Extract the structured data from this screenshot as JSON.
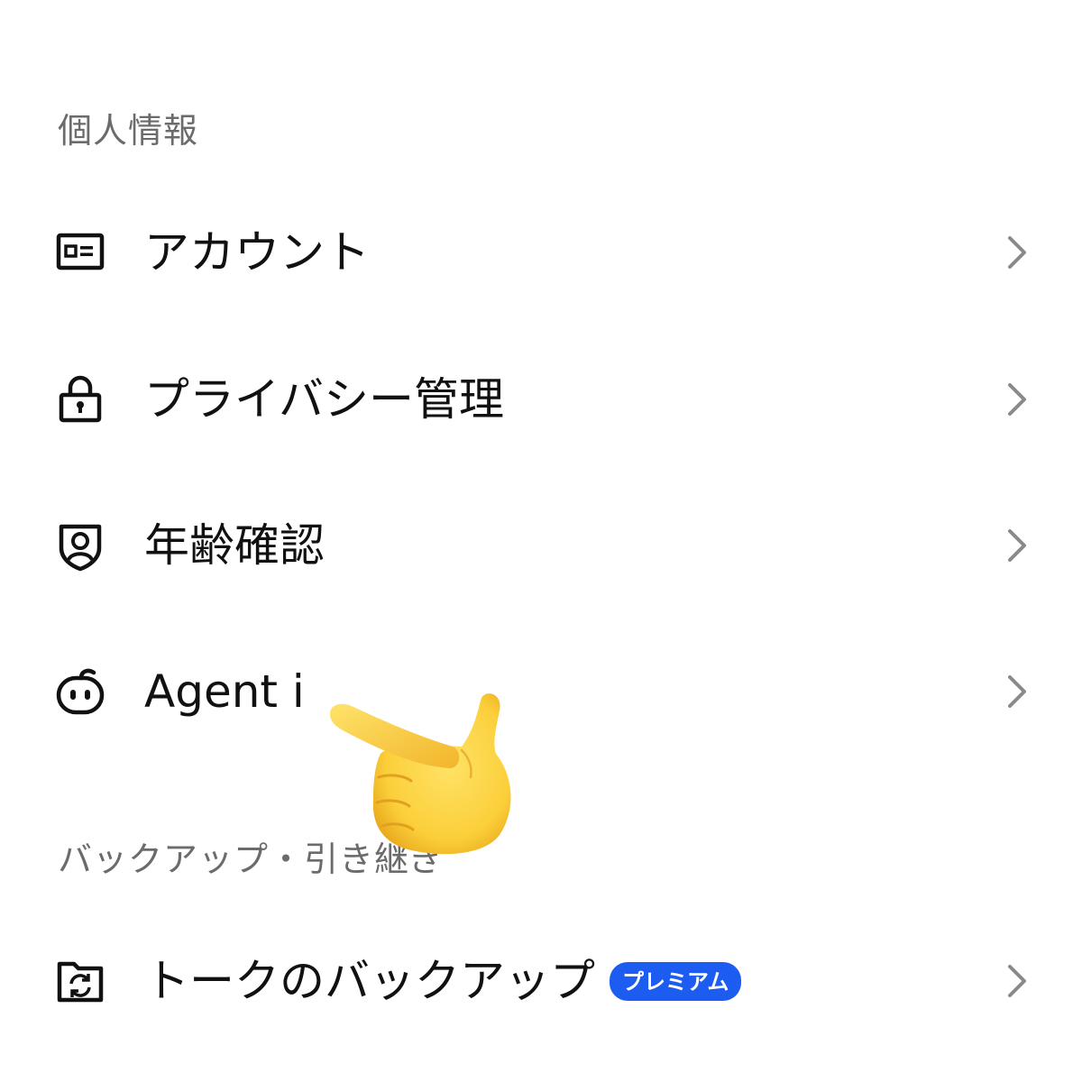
{
  "sections": {
    "personal": {
      "header": "個人情報",
      "items": [
        {
          "label": "アカウント",
          "icon": "id-card-icon"
        },
        {
          "label": "プライバシー管理",
          "icon": "lock-icon"
        },
        {
          "label": "年齢確認",
          "icon": "shield-person-icon"
        },
        {
          "label": "Agent i",
          "icon": "agent-bot-icon"
        }
      ]
    },
    "backup": {
      "header": "バックアップ・引き継ぎ",
      "items": [
        {
          "label": "トークのバックアップ",
          "icon": "folder-sync-icon",
          "badge": "プレミアム"
        }
      ]
    }
  },
  "colors": {
    "header_text": "#6b6b6b",
    "item_text": "#111111",
    "chevron": "#8a8a8a",
    "badge_bg": "#1d5cf0",
    "badge_text": "#ffffff"
  },
  "overlay": {
    "icon": "pointing-hand-emoji"
  }
}
